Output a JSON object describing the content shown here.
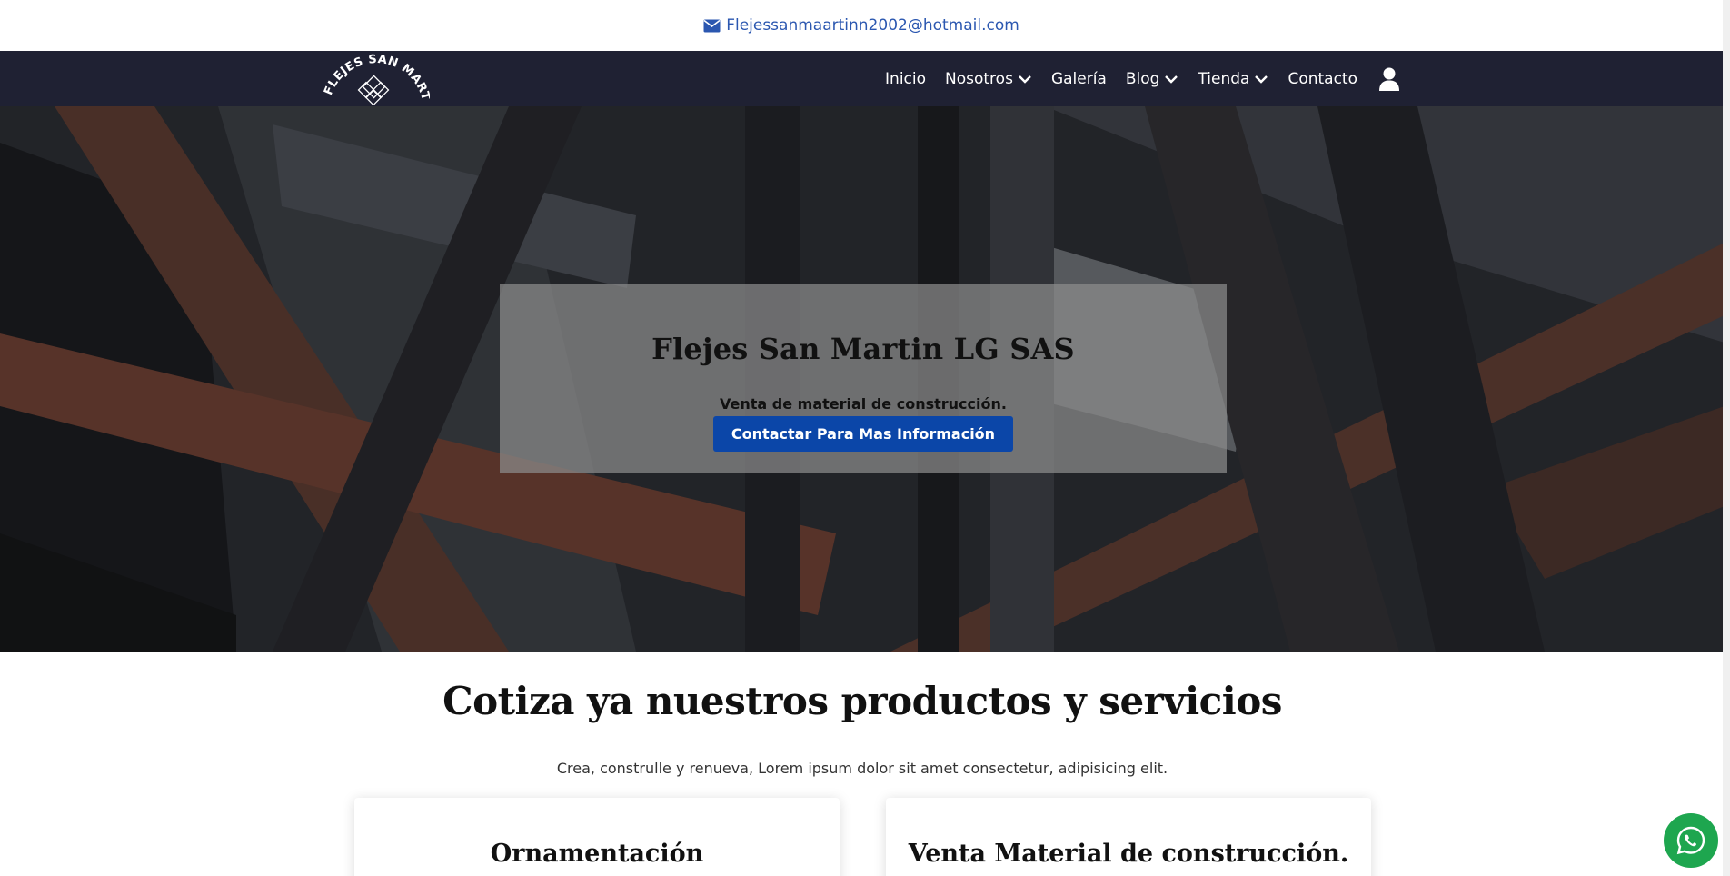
{
  "topbar": {
    "email": "Flejessanmaartinn2002@hotmail.com",
    "email_icon": "envelope-icon",
    "color": "#2b57b0"
  },
  "brand": {
    "logo_text": "FLEJES SAN MARTIN",
    "nav_bg": "#1f2133"
  },
  "nav": {
    "items": [
      {
        "label": "Inicio",
        "dropdown": false
      },
      {
        "label": "Nosotros",
        "dropdown": true
      },
      {
        "label": "Galería",
        "dropdown": false
      },
      {
        "label": "Blog",
        "dropdown": true
      },
      {
        "label": "Tienda",
        "dropdown": true
      },
      {
        "label": "Contacto",
        "dropdown": false
      }
    ],
    "user_icon": "user-icon"
  },
  "hero": {
    "title": "Flejes San Martin LG SAS",
    "subtitle": "Venta de material de construcción.",
    "cta": "Contactar Para Mas Información",
    "cta_color": "#0b46a8"
  },
  "services": {
    "title": "Cotiza ya nuestros productos y servicios",
    "subtitle": "Crea, construlle y renueva, Lorem ipsum dolor sit amet consectetur, adipisicing elit.",
    "cards": [
      {
        "title": "Ornamentación"
      },
      {
        "title": "Venta Material de construcción."
      }
    ]
  },
  "whatsapp": {
    "icon": "whatsapp-icon",
    "color": "#1ea64f"
  }
}
